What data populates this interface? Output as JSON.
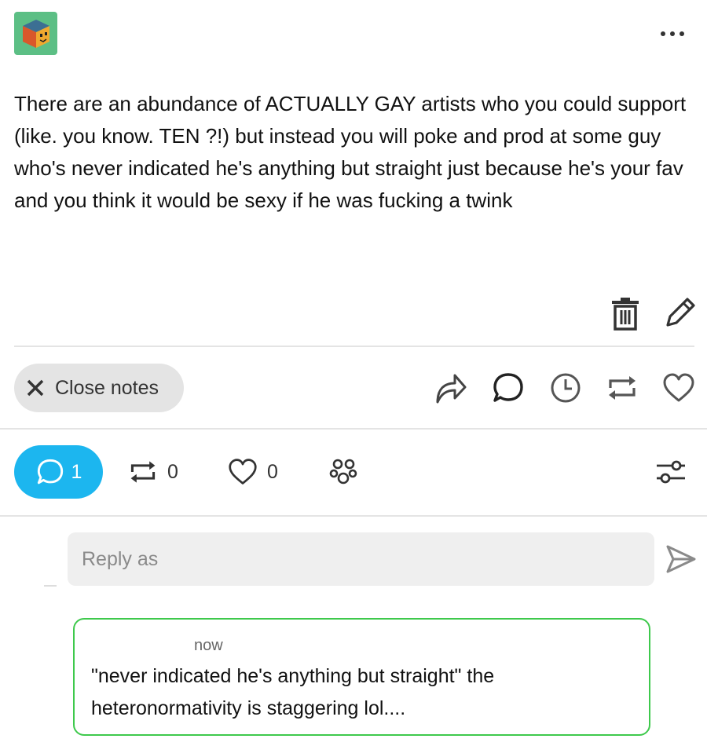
{
  "post": {
    "avatar_icon": "cube-face-icon",
    "more_icon": "more-horizontal-icon",
    "body": "There are an abundance of ACTUALLY GAY artists who you could support (like. you know. TEN ?!) but instead you will poke and prod at some guy who's never indicated he's anything but straight just because he's your fav and you think it would be sexy if he was fucking a twink",
    "edit_actions": [
      "trash-icon",
      "pencil-icon"
    ]
  },
  "action_bar": {
    "close_notes_label": "Close notes",
    "icons": [
      "share-icon",
      "comment-icon",
      "clock-icon",
      "reblog-icon",
      "heart-icon"
    ]
  },
  "notes_tabs": {
    "comments_count": "1",
    "reblogs_count": "0",
    "likes_count": "0",
    "accent_color": "#1cb6ef"
  },
  "reply_box": {
    "placeholder": "Reply as"
  },
  "reply": {
    "time": "now",
    "text": "\"never indicated he's anything but straight\" the heteronormativity is staggering lol....",
    "border_color": "#3ec94c"
  }
}
